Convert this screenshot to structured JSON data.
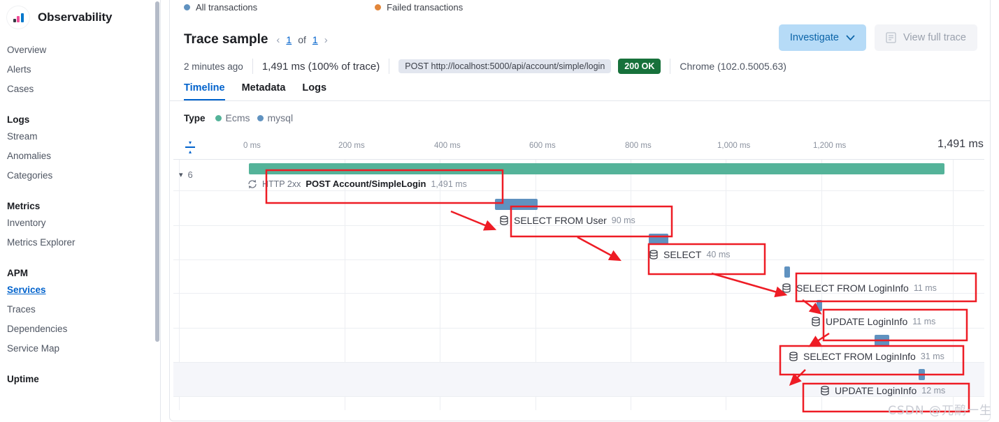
{
  "sidebar": {
    "brand": "Observability",
    "groups": [
      {
        "title": "",
        "items": [
          {
            "label": "Overview",
            "active": false
          },
          {
            "label": "Alerts",
            "active": false
          },
          {
            "label": "Cases",
            "active": false
          }
        ]
      },
      {
        "title": "Logs",
        "items": [
          {
            "label": "Stream",
            "active": false
          },
          {
            "label": "Anomalies",
            "active": false
          },
          {
            "label": "Categories",
            "active": false
          }
        ]
      },
      {
        "title": "Metrics",
        "items": [
          {
            "label": "Inventory",
            "active": false
          },
          {
            "label": "Metrics Explorer",
            "active": false
          }
        ]
      },
      {
        "title": "APM",
        "items": [
          {
            "label": "Services",
            "active": true
          },
          {
            "label": "Traces",
            "active": false
          },
          {
            "label": "Dependencies",
            "active": false
          },
          {
            "label": "Service Map",
            "active": false
          }
        ]
      },
      {
        "title": "Uptime",
        "items": []
      }
    ]
  },
  "legend": {
    "all_transactions": "All transactions",
    "all_color": "#6092c0",
    "failed_transactions": "Failed transactions",
    "failed_color": "#e2863a"
  },
  "trace": {
    "title": "Trace sample",
    "page_current": "1",
    "page_of": "of",
    "page_total": "1",
    "prev_icon": "chevron-left-icon",
    "next_icon": "chevron-right-icon",
    "investigate_label": "Investigate",
    "view_full_trace_label": "View full trace",
    "timestamp": "2 minutes ago",
    "duration": "1,491 ms (100% of trace)",
    "url": "POST http://localhost:5000/api/account/simple/login",
    "status": "200 OK",
    "status_color": "#17713b",
    "agent": "Chrome (102.0.5005.63)"
  },
  "tabs": [
    {
      "label": "Timeline",
      "active": true
    },
    {
      "label": "Metadata",
      "active": false
    },
    {
      "label": "Logs",
      "active": false
    }
  ],
  "type_legend": {
    "label": "Type",
    "items": [
      {
        "name": "Ecms",
        "color": "#54b399"
      },
      {
        "name": "mysql",
        "color": "#6092c0"
      }
    ]
  },
  "chart_data": {
    "type": "bar",
    "title": "Trace waterfall timeline",
    "xlabel": "",
    "ylabel": "",
    "xlim": [
      0,
      1491
    ],
    "unit": "ms",
    "grid": true,
    "axis_ticks": [
      "0 ms",
      "200 ms",
      "400 ms",
      "600 ms",
      "800 ms",
      "1,000 ms",
      "1,200 ms"
    ],
    "axis_end_label": "1,491 ms",
    "child_count": "6",
    "spans": [
      {
        "status": "HTTP 2xx",
        "name": "POST Account/SimpleLogin",
        "duration_label": "1,491 ms",
        "duration_ms": 1491,
        "start_ms": 0,
        "color": "#54b399",
        "type": "Ecms",
        "icon": "sync-icon",
        "depth": 0,
        "highlighted": true
      },
      {
        "status": "",
        "name": "SELECT FROM User",
        "duration_label": "90 ms",
        "duration_ms": 90,
        "start_ms": 455,
        "color": "#6092c0",
        "type": "mysql",
        "icon": "database-icon",
        "depth": 1,
        "highlighted": true
      },
      {
        "status": "",
        "name": "SELECT",
        "duration_label": "40 ms",
        "duration_ms": 40,
        "start_ms": 713,
        "color": "#6092c0",
        "type": "mysql",
        "icon": "database-icon",
        "depth": 2,
        "highlighted": true
      },
      {
        "status": "",
        "name": "SELECT FROM LoginInfo",
        "duration_label": "11 ms",
        "duration_ms": 11,
        "start_ms": 975,
        "color": "#6092c0",
        "type": "mysql",
        "icon": "database-icon",
        "depth": 3,
        "highlighted": true
      },
      {
        "status": "",
        "name": "UPDATE LoginInfo",
        "duration_label": "11 ms",
        "duration_ms": 11,
        "start_ms": 1040,
        "color": "#6092c0",
        "type": "mysql",
        "icon": "database-icon",
        "depth": 4,
        "highlighted": true
      },
      {
        "status": "",
        "name": "SELECT FROM LoginInfo",
        "duration_label": "31 ms",
        "duration_ms": 31,
        "start_ms": 1213,
        "color": "#6092c0",
        "type": "mysql",
        "icon": "database-icon",
        "depth": 5,
        "highlighted": true
      },
      {
        "status": "",
        "name": "UPDATE LoginInfo",
        "duration_label": "12 ms",
        "duration_ms": 12,
        "start_ms": 1305,
        "color": "#6092c0",
        "type": "mysql",
        "icon": "database-icon",
        "depth": 6,
        "highlighted": true
      }
    ]
  },
  "watermark": "CSDN @兀鸸一生"
}
